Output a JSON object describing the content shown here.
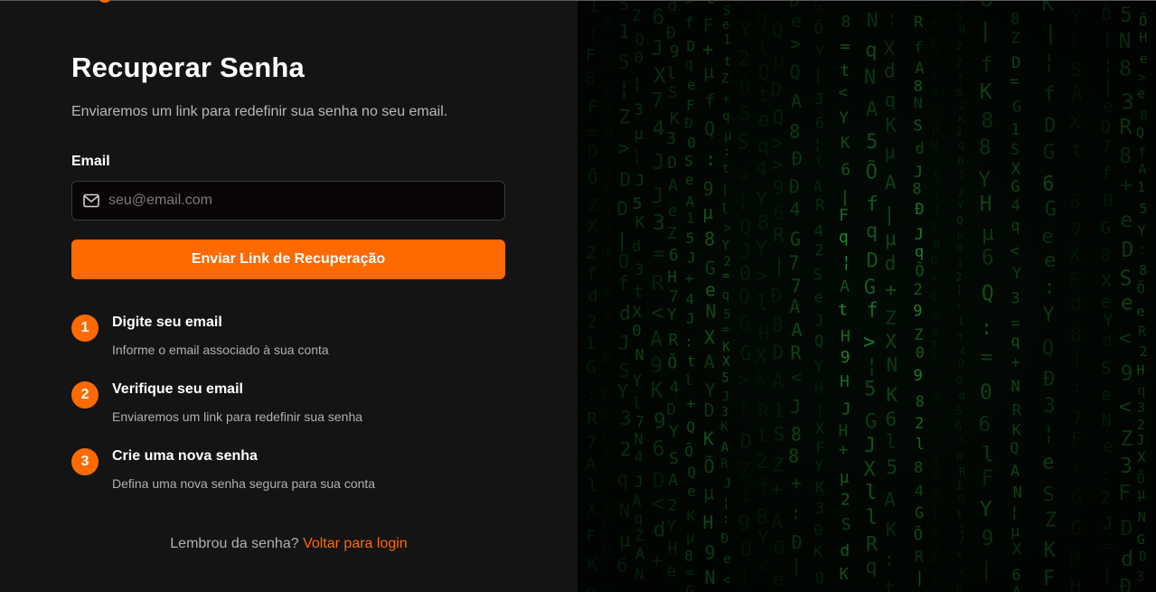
{
  "page": {
    "title": "Recuperar Senha",
    "subtitle": "Enviaremos um link para redefinir sua senha no seu email."
  },
  "form": {
    "email_label": "Email",
    "email_placeholder": "seu@email.com",
    "email_value": "",
    "submit_label": "Enviar Link de Recuperação"
  },
  "steps": [
    {
      "number": "1",
      "title": "Digite seu email",
      "description": "Informe o email associado à sua conta"
    },
    {
      "number": "2",
      "title": "Verifique seu email",
      "description": "Enviaremos um link para redefinir sua senha"
    },
    {
      "number": "3",
      "title": "Crie uma nova senha",
      "description": "Defina uma nova senha segura para sua conta"
    }
  ],
  "footer": {
    "prompt": "Lembrou da senha?",
    "link_label": "Voltar para login"
  },
  "icons": {
    "email_input": "mail-icon",
    "background": "matrix-code-rain-image"
  },
  "colors": {
    "accent": "#ff6a00",
    "background": "#141414",
    "matrix_green": "#1fbf4a"
  }
}
